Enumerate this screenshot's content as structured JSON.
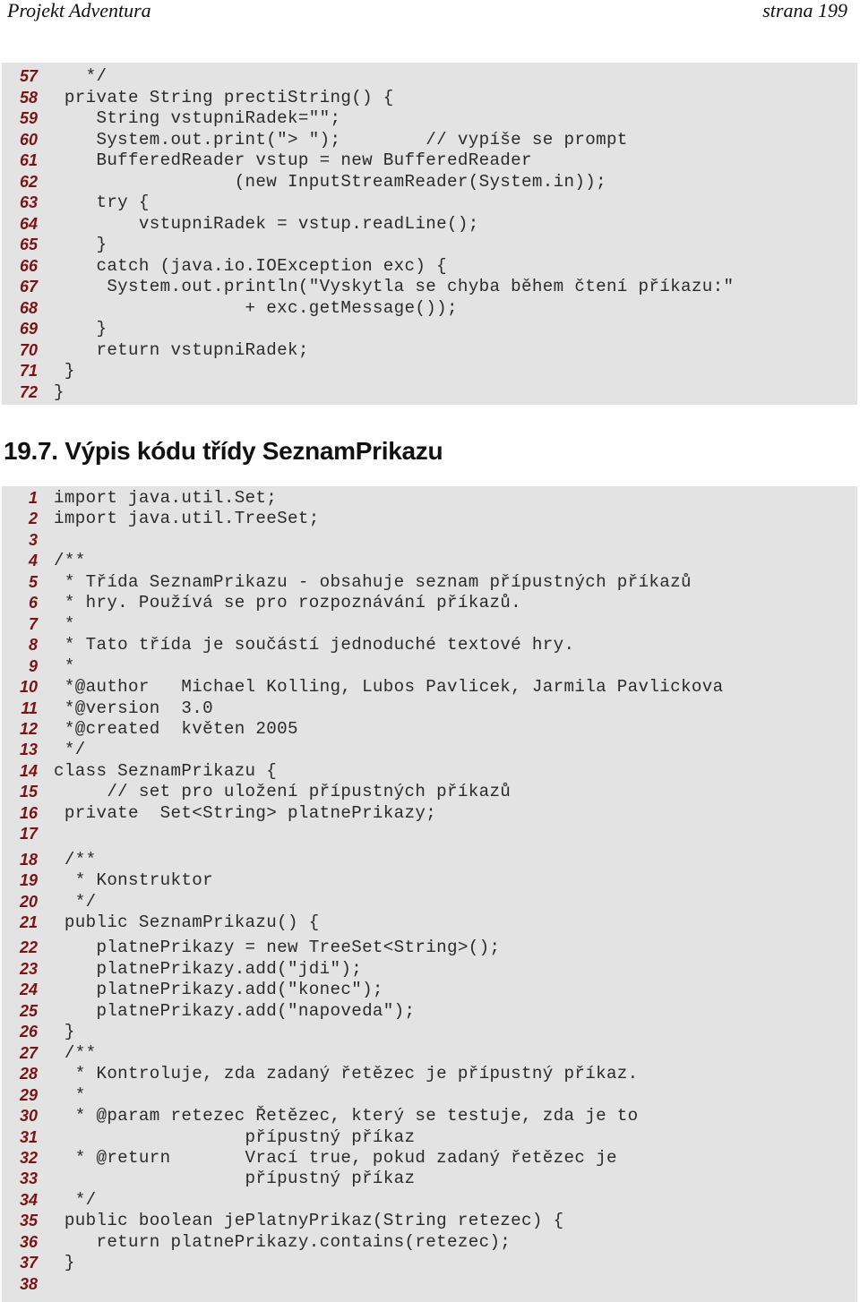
{
  "header": {
    "title": "Projekt Adventura",
    "page": "strana 199"
  },
  "block1": {
    "lines": [
      {
        "n": "57",
        "code": "   */"
      },
      {
        "n": "58",
        "code": " private String prectiString() {"
      },
      {
        "n": "59",
        "code": "    String vstupniRadek=\"\";"
      },
      {
        "n": "60",
        "code": "    System.out.print(\"> \");        // vypíše se prompt"
      },
      {
        "n": "61",
        "code": "    BufferedReader vstup = new BufferedReader"
      },
      {
        "n": "62",
        "code": "                 (new InputStreamReader(System.in));"
      },
      {
        "n": "63",
        "code": "    try {"
      },
      {
        "n": "64",
        "code": "        vstupniRadek = vstup.readLine();"
      },
      {
        "n": "65",
        "code": "    }"
      },
      {
        "n": "66",
        "code": "    catch (java.io.IOException exc) {"
      },
      {
        "n": "67",
        "code": "     System.out.println(\"Vyskytla se chyba během čtení příkazu:\""
      },
      {
        "n": "68",
        "code": "                  + exc.getMessage());"
      },
      {
        "n": "69",
        "code": "    }"
      },
      {
        "n": "70",
        "code": "    return vstupniRadek;"
      },
      {
        "n": "71",
        "code": " }"
      },
      {
        "n": "72",
        "code": "}"
      }
    ]
  },
  "section_heading": "19.7. Výpis kódu třídy SeznamPrikazu",
  "block2": {
    "lines": [
      {
        "n": "1",
        "code": "import java.util.Set;"
      },
      {
        "n": "2",
        "code": "import java.util.TreeSet;"
      },
      {
        "n": "3",
        "code": ""
      },
      {
        "n": "4",
        "code": "/**"
      },
      {
        "n": "5",
        "code": " * Třída SeznamPrikazu - obsahuje seznam přípustných příkazů"
      },
      {
        "n": "6",
        "code": " * hry. Používá se pro rozpoznávání příkazů."
      },
      {
        "n": "7",
        "code": " *"
      },
      {
        "n": "8",
        "code": " * Tato třída je součástí jednoduché textové hry."
      },
      {
        "n": "9",
        "code": " *"
      },
      {
        "n": "10",
        "code": " *@author   Michael Kolling, Lubos Pavlicek, Jarmila Pavlickova"
      },
      {
        "n": "11",
        "code": " *@version  3.0"
      },
      {
        "n": "12",
        "code": " *@created  květen 2005"
      },
      {
        "n": "13",
        "code": " */"
      },
      {
        "n": "14",
        "code": "class SeznamPrikazu {"
      },
      {
        "n": "15",
        "code": "     // set pro uložení přípustných příkazů"
      },
      {
        "n": "16",
        "code": " private  Set<String> platnePrikazy;"
      },
      {
        "n": "17",
        "code": ""
      },
      {
        "n": "18",
        "code": " /**"
      },
      {
        "n": "19",
        "code": "  * Konstruktor"
      },
      {
        "n": "20",
        "code": "  */"
      },
      {
        "n": "21",
        "code": " public SeznamPrikazu() {"
      },
      {
        "n": "22",
        "code": "    platnePrikazy = new TreeSet<String>();"
      },
      {
        "n": "23",
        "code": "    platnePrikazy.add(\"jdi\");"
      },
      {
        "n": "24",
        "code": "    platnePrikazy.add(\"konec\");"
      },
      {
        "n": "25",
        "code": "    platnePrikazy.add(\"napoveda\");"
      },
      {
        "n": "26",
        "code": " }"
      },
      {
        "n": "27",
        "code": " /**"
      },
      {
        "n": "28",
        "code": "  * Kontroluje, zda zadaný řetězec je přípustný příkaz."
      },
      {
        "n": "29",
        "code": "  *"
      },
      {
        "n": "30",
        "code": "  * @param retezec Řetězec, který se testuje, zda je to"
      },
      {
        "n": "31",
        "code": "                  přípustný příkaz"
      },
      {
        "n": "32",
        "code": "  * @return       Vrací true, pokud zadaný řetězec je"
      },
      {
        "n": "33",
        "code": "                  přípustný příkaz"
      },
      {
        "n": "34",
        "code": "  */"
      },
      {
        "n": "35",
        "code": " public boolean jePlatnyPrikaz(String retezec) {"
      },
      {
        "n": "36",
        "code": "    return platnePrikazy.contains(retezec);"
      },
      {
        "n": "37",
        "code": " }"
      },
      {
        "n": "38",
        "code": ""
      }
    ]
  }
}
